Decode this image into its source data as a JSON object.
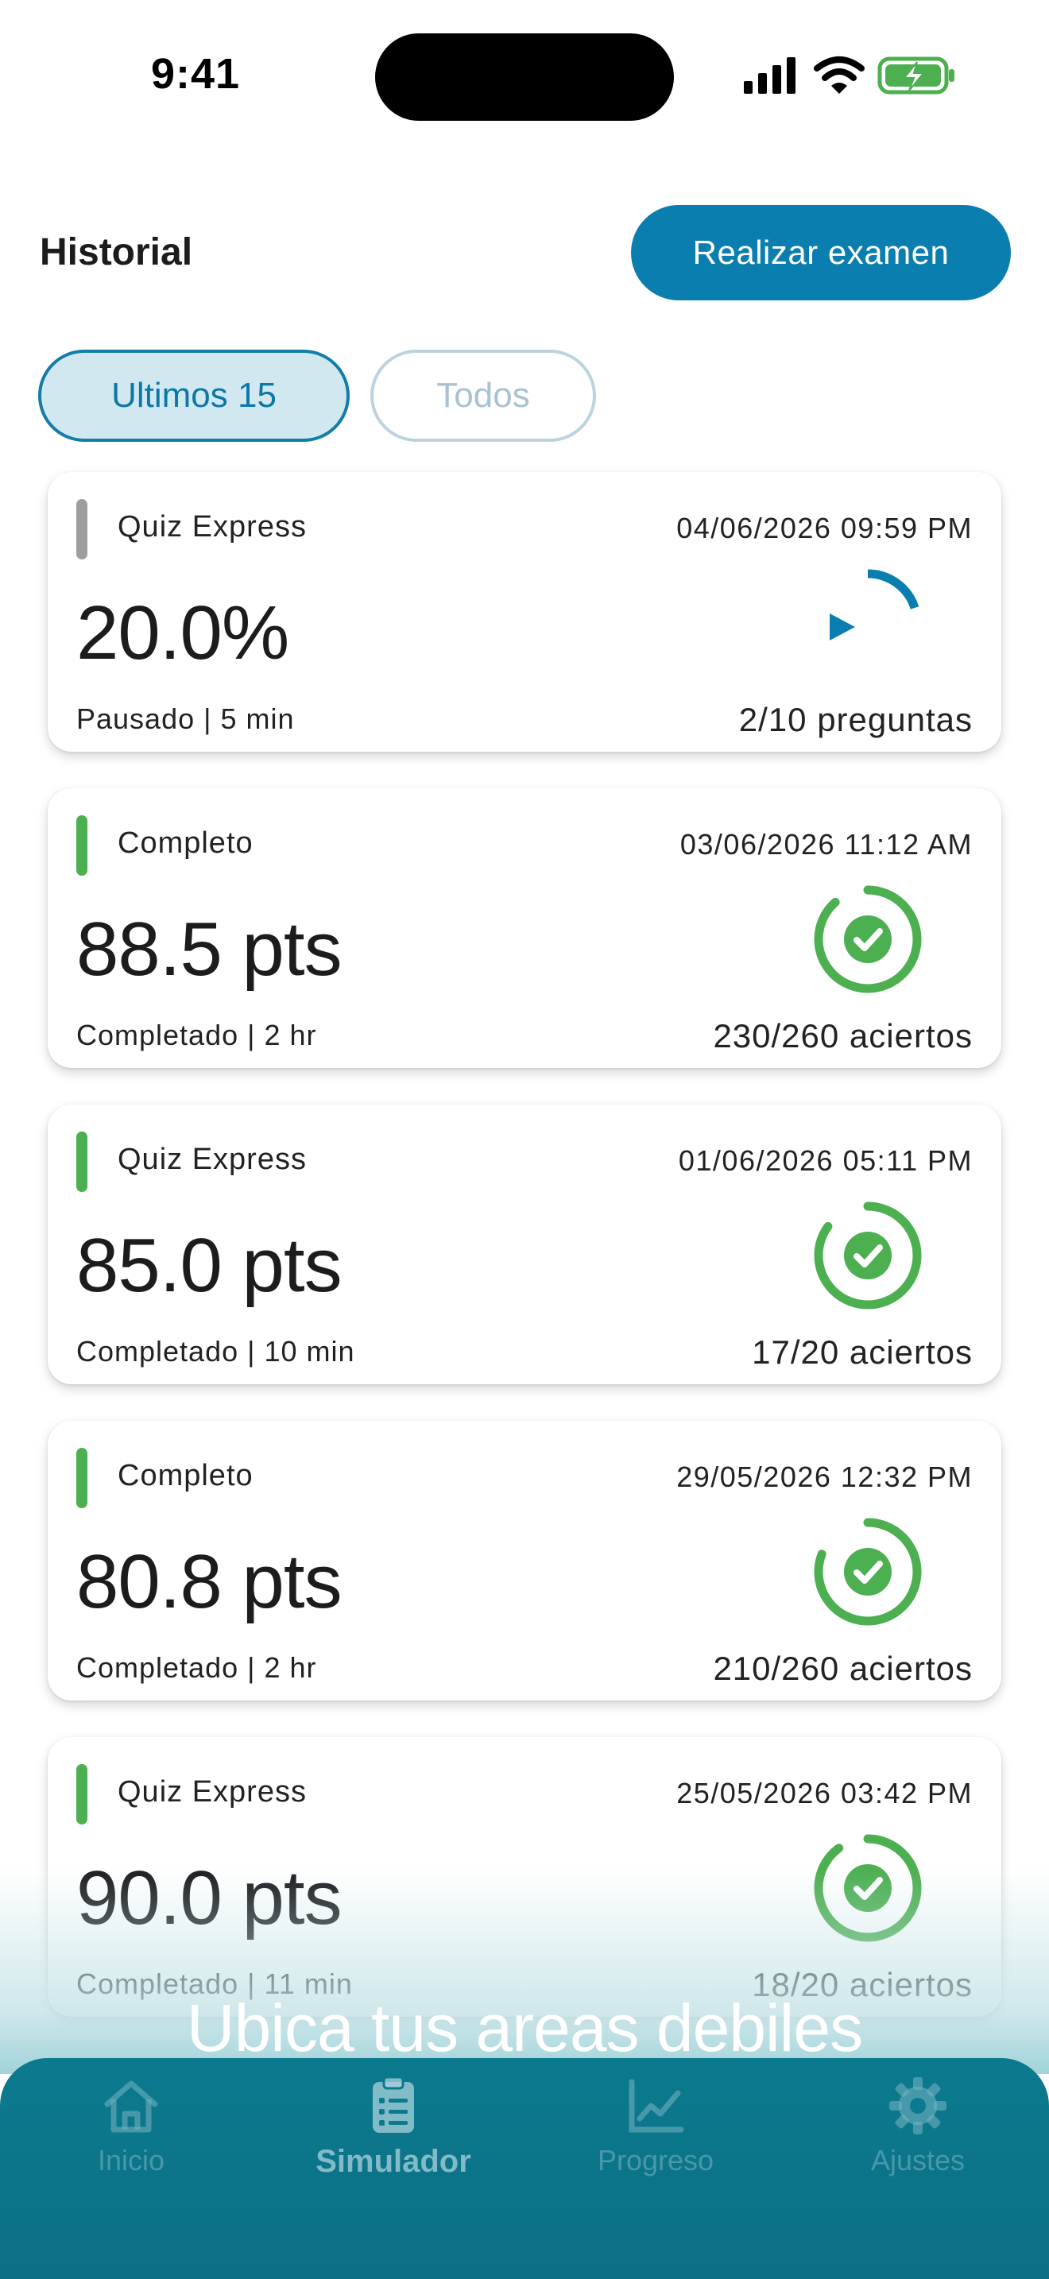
{
  "status_bar": {
    "time": "9:41"
  },
  "header": {
    "title": "Historial",
    "primary_action": "Realizar examen"
  },
  "filters": [
    {
      "label": "Ultimos 15",
      "selected": true
    },
    {
      "label": "Todos",
      "selected": false
    }
  ],
  "history": [
    {
      "type": "Quiz Express",
      "date": "04/06/2026 09:59 PM",
      "score": "20.0%",
      "status": "Pausado | 5 min",
      "count": "2/10 preguntas",
      "state": "paused",
      "progress": 0.2,
      "accent_color": "#9e9e9e"
    },
    {
      "type": "Completo",
      "date": "03/06/2026 11:12 AM",
      "score": "88.5 pts",
      "status": "Completado | 2 hr",
      "count": "230/260 aciertos",
      "state": "completed",
      "progress": 0.885,
      "accent_color": "#4caf50"
    },
    {
      "type": "Quiz Express",
      "date": "01/06/2026 05:11 PM",
      "score": "85.0 pts",
      "status": "Completado | 10 min",
      "count": "17/20 aciertos",
      "state": "completed",
      "progress": 0.85,
      "accent_color": "#4caf50"
    },
    {
      "type": "Completo",
      "date": "29/05/2026 12:32 PM",
      "score": "80.8 pts",
      "status": "Completado | 2 hr",
      "count": "210/260 aciertos",
      "state": "completed",
      "progress": 0.808,
      "accent_color": "#4caf50"
    },
    {
      "type": "Quiz Express",
      "date": "25/05/2026 03:42 PM",
      "score": "90.0 pts",
      "status": "Completado | 11 min",
      "count": "18/20 aciertos",
      "state": "completed",
      "progress": 0.9,
      "accent_color": "#4caf50"
    }
  ],
  "overlay_caption": "Ubica tus areas debiles",
  "tab_bar": [
    {
      "label": "Inicio",
      "icon": "home-icon",
      "active": false
    },
    {
      "label": "Simulador",
      "icon": "clipboard-list-icon",
      "active": true
    },
    {
      "label": "Progreso",
      "icon": "line-chart-icon",
      "active": false
    },
    {
      "label": "Ajustes",
      "icon": "gear-icon",
      "active": false
    }
  ],
  "colors": {
    "primary": "#0a7eae",
    "success": "#4caf50",
    "paused": "#9e9e9e",
    "tab_bar": "#0b7a8e"
  }
}
